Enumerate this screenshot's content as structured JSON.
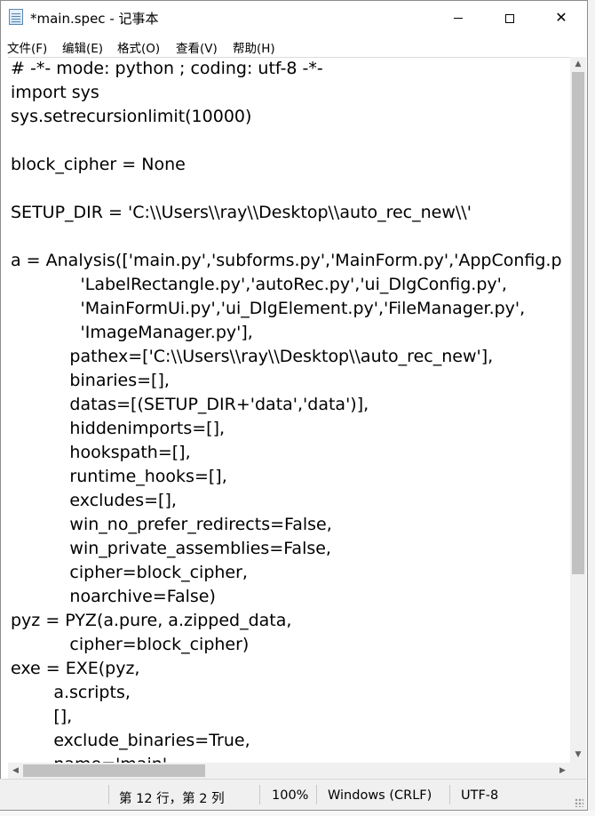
{
  "window": {
    "title": "*main.spec - 记事本",
    "controls": {
      "minimize": "–",
      "maximize": "□",
      "close": "✕"
    }
  },
  "menu": {
    "items": [
      "文件(F)",
      "编辑(E)",
      "格式(O)",
      "查看(V)",
      "帮助(H)"
    ]
  },
  "editor": {
    "lines": [
      "# -*- mode: python ; coding: utf-8 -*-",
      "import sys",
      "sys.setrecursionlimit(10000)",
      "",
      "block_cipher = None",
      "",
      "SETUP_DIR = 'C:\\\\Users\\\\ray\\\\Desktop\\\\auto_rec_new\\\\'",
      "",
      "a = Analysis(['main.py','subforms.py','MainForm.py','AppConfig.p",
      "             'LabelRectangle.py','autoRec.py','ui_DlgConfig.py',",
      "             'MainFormUi.py','ui_DlgElement.py','FileManager.py',",
      "             'ImageManager.py'],",
      "           pathex=['C:\\\\Users\\\\ray\\\\Desktop\\\\auto_rec_new'],",
      "           binaries=[],",
      "           datas=[(SETUP_DIR+'data','data')],",
      "           hiddenimports=[],",
      "           hookspath=[],",
      "           runtime_hooks=[],",
      "           excludes=[],",
      "           win_no_prefer_redirects=False,",
      "           win_private_assemblies=False,",
      "           cipher=block_cipher,",
      "           noarchive=False)",
      "pyz = PYZ(a.pure, a.zipped_data,",
      "           cipher=block_cipher)",
      "exe = EXE(pyz,",
      "        a.scripts,",
      "        [],",
      "        exclude_binaries=True,",
      "        name='main',"
    ]
  },
  "status": {
    "position": "第 12 行，第 2 列",
    "zoom": "100%",
    "line_ending": "Windows (CRLF)",
    "encoding": "UTF-8"
  }
}
